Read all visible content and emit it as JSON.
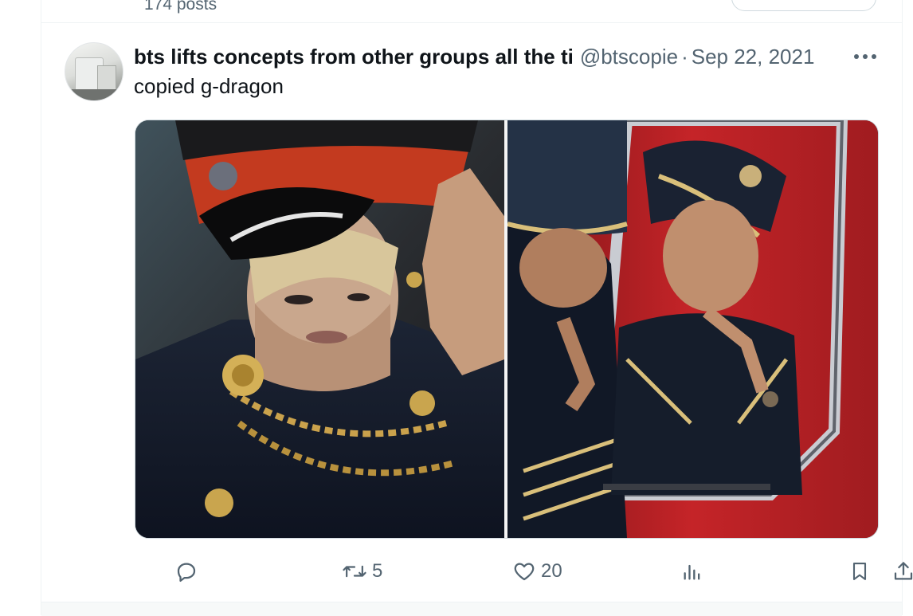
{
  "profile": {
    "posts_count": "174 posts"
  },
  "tweet": {
    "display_name": "bts lifts concepts from other groups all the ti",
    "handle": "@btscopie",
    "separator": "·",
    "date": "Sep 22, 2021",
    "text": "copied g-dragon",
    "more_icon": "more-horizontal-icon",
    "media": {
      "left_image": "man-in-red-black-military-cap-and-navy-coat-with-gold-chains",
      "right_image": "man-in-military-cap-looking-into-mirror-with-red-background"
    },
    "actions": {
      "reply": {
        "icon": "reply-icon",
        "count": ""
      },
      "retweet": {
        "icon": "retweet-icon",
        "count": "5"
      },
      "like": {
        "icon": "heart-icon",
        "count": "20"
      },
      "views": {
        "icon": "views-icon",
        "count": ""
      },
      "bookmark": {
        "icon": "bookmark-icon"
      },
      "share": {
        "icon": "share-icon"
      }
    }
  },
  "colors": {
    "text_primary": "#0f1419",
    "text_secondary": "#536471",
    "border": "#eff3f4"
  }
}
